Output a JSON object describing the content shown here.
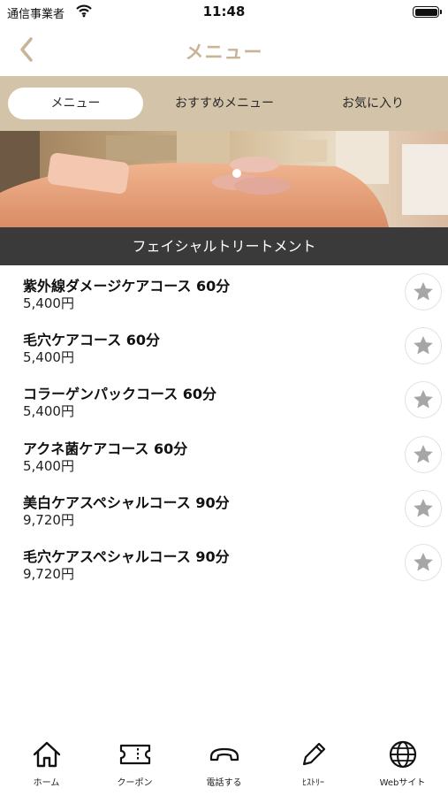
{
  "status_bar": {
    "carrier": "通信事業者",
    "time": "11:48"
  },
  "nav": {
    "title": "メニュー",
    "back_icon": "chevron-left-icon"
  },
  "tabs": [
    {
      "label": "メニュー",
      "active": true
    },
    {
      "label": "おすすめメニュー",
      "active": false
    },
    {
      "label": "お気に入り",
      "active": false
    }
  ],
  "section": {
    "title": "フェイシャルトリートメント"
  },
  "menu_items": [
    {
      "name": "紫外線ダメージケアコース 60分",
      "price": "5,400円"
    },
    {
      "name": "毛穴ケアコース 60分",
      "price": "5,400円"
    },
    {
      "name": "コラーゲンパックコース 60分",
      "price": "5,400円"
    },
    {
      "name": "アクネ菌ケアコース 60分",
      "price": "5,400円"
    },
    {
      "name": "美白ケアスペシャルコース 90分",
      "price": "9,720円"
    },
    {
      "name": "毛穴ケアスペシャルコース 90分",
      "price": "9,720円"
    }
  ],
  "bottom_tabs": [
    {
      "label": "ホーム",
      "icon": "home-icon"
    },
    {
      "label": "クーポン",
      "icon": "ticket-icon"
    },
    {
      "label": "電話する",
      "icon": "phone-icon"
    },
    {
      "label": "ﾋｽﾄﾘｰ",
      "icon": "pencil-icon"
    },
    {
      "label": "Webサイト",
      "icon": "globe-icon"
    }
  ],
  "colors": {
    "accent": "#c8b497",
    "tab_bar_bg": "#d2c3a9",
    "section_bg": "#3a3a3a",
    "star": "#a6a6a6"
  }
}
